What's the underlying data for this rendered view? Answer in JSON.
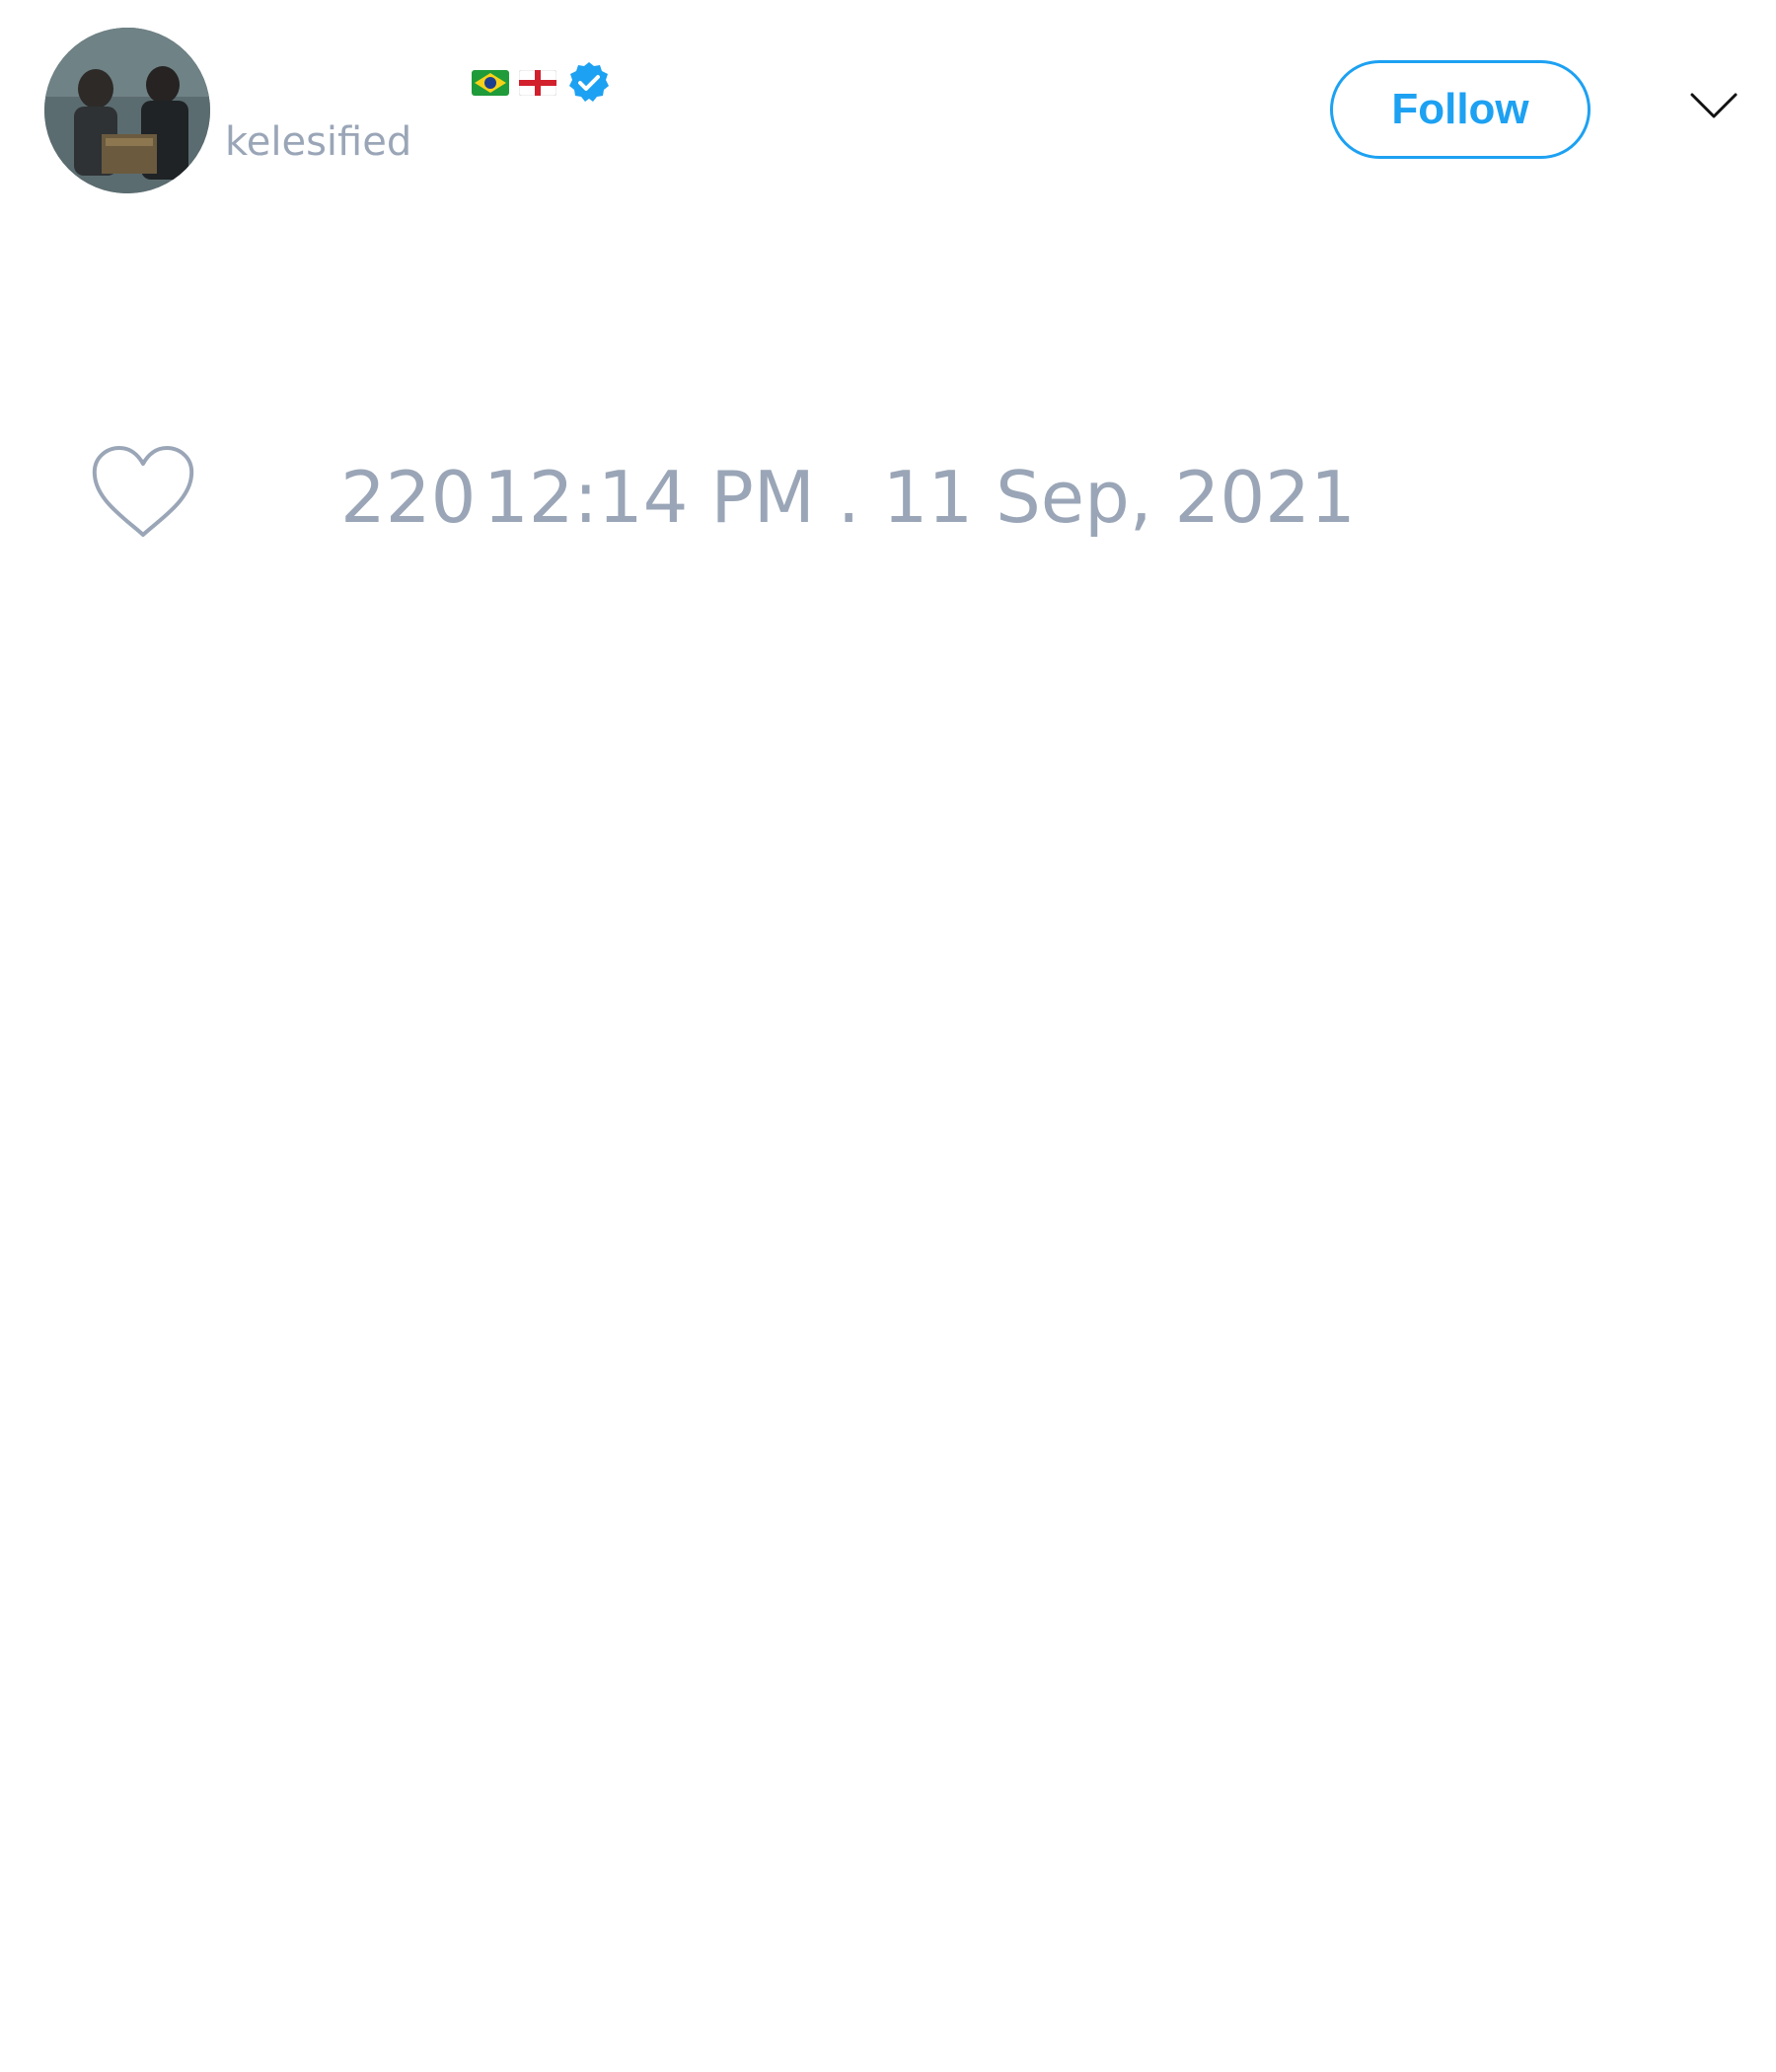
{
  "user": {
    "handle": "kelesified",
    "flags": [
      "brazil-flag-icon",
      "england-flag-icon"
    ],
    "verified": true,
    "verified_color": "#1da1f2"
  },
  "header": {
    "follow_label": "Follow",
    "accent_color": "#1da1f2"
  },
  "tweet": {
    "like_count": "220",
    "timestamp": "12:14 PM . 11 Sep, 2021"
  },
  "colors": {
    "muted_text": "#9aa6b7",
    "background": "#ffffff"
  }
}
